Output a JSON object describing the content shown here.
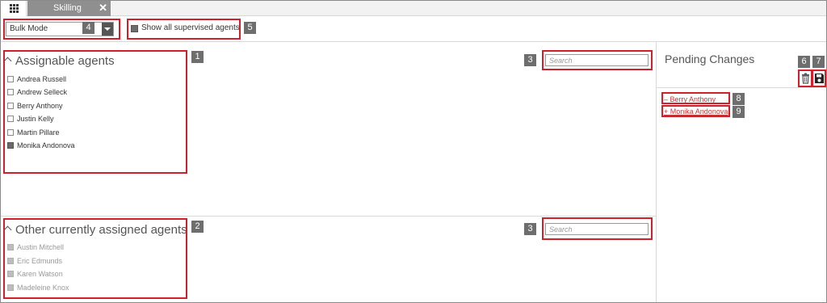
{
  "tab": {
    "title": "Skilling",
    "close_icon": "close-icon"
  },
  "apps_icon": "grid-icon",
  "toolbar": {
    "mode_value": "Bulk Mode",
    "supervised_label": "Show all supervised agents",
    "supervised_checked": true
  },
  "assignable": {
    "title": "Assignable agents",
    "search_placeholder": "Search",
    "agents": [
      {
        "name": "Andrea Russell",
        "checked": false
      },
      {
        "name": "Andrew Selleck",
        "checked": false
      },
      {
        "name": "Berry Anthony",
        "checked": false
      },
      {
        "name": "Justin Kelly",
        "checked": false
      },
      {
        "name": "Martin Pillare",
        "checked": false
      },
      {
        "name": "Monika Andonova",
        "checked": true
      }
    ]
  },
  "other": {
    "title": "Other currently assigned agents",
    "search_placeholder": "Search",
    "agents": [
      {
        "name": "Austin Mitchell"
      },
      {
        "name": "Eric Edmunds"
      },
      {
        "name": "Karen Watson"
      },
      {
        "name": "Madeleine Knox"
      }
    ]
  },
  "pending": {
    "title": "Pending Changes",
    "delete_icon": "trash-icon",
    "save_icon": "save-icon",
    "changes": [
      {
        "sign": "–",
        "name": "Berry Anthony"
      },
      {
        "sign": "+",
        "name": "Monika Andonova"
      }
    ]
  },
  "callouts": [
    "1",
    "2",
    "3",
    "3",
    "4",
    "5",
    "6",
    "7",
    "8",
    "9"
  ],
  "colors": {
    "annotation": "#d0202c",
    "badge": "#6e6e6e",
    "tab": "#8f8f8f",
    "change_link": "#c23a3a"
  }
}
